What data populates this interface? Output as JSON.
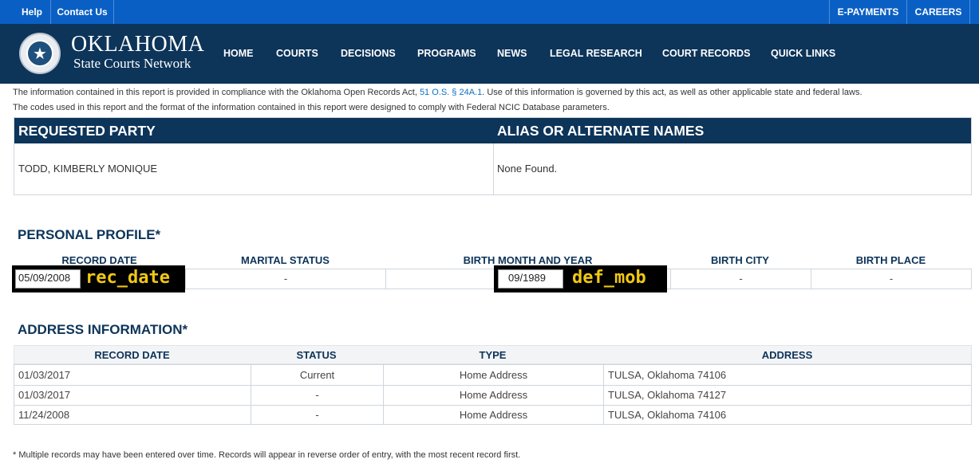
{
  "utility": {
    "help": "Help",
    "contact": "Contact Us",
    "epayments": "E-PAYMENTS",
    "careers": "CAREERS"
  },
  "brand": {
    "name": "OKLAHOMA",
    "subtitle": "State Courts Network",
    "seal_icon": "state-seal-icon"
  },
  "nav": {
    "items": [
      "HOME",
      "COURTS",
      "DECISIONS",
      "PROGRAMS",
      "NEWS",
      "LEGAL RESEARCH",
      "COURT RECORDS",
      "QUICK LINKS"
    ]
  },
  "notice": {
    "line1_before": "The information contained in this report is provided in compliance with the Oklahoma Open Records Act, ",
    "line1_link": "51 O.S. § 24A.1",
    "line1_after": ". Use of this information is governed by this act, as well as other applicable state and federal laws.",
    "line2": "The codes used in this report and the format of the information contained in this report were designed to comply with Federal NCIC Database parameters."
  },
  "party": {
    "requested_header": "REQUESTED PARTY",
    "alias_header": "ALIAS OR ALTERNATE NAMES",
    "requested_name": "TODD, KIMBERLY MONIQUE",
    "alias_value": "None Found."
  },
  "profile": {
    "title": "PERSONAL PROFILE*",
    "headers": {
      "record_date": "RECORD DATE",
      "marital_status": "MARITAL STATUS",
      "birth_month_year": "BIRTH MONTH AND YEAR",
      "birth_city": "BIRTH CITY",
      "birth_place": "BIRTH PLACE"
    },
    "row": {
      "record_date": "05/09/2008",
      "marital_status": "-",
      "birth_month_year": "09/1989",
      "birth_city": "-",
      "birth_place": "-"
    },
    "record_date_tag": "rec_date",
    "birth_tag": "def_mob"
  },
  "address": {
    "title": "ADDRESS INFORMATION*",
    "headers": {
      "record_date": "RECORD DATE",
      "status": "STATUS",
      "type": "TYPE",
      "address": "ADDRESS"
    },
    "rows": [
      {
        "record_date": "01/03/2017",
        "status": "Current",
        "type": "Home Address",
        "address": "TULSA, Oklahoma  74106"
      },
      {
        "record_date": "01/03/2017",
        "status": "-",
        "type": "Home Address",
        "address": "TULSA, Oklahoma  74127"
      },
      {
        "record_date": "11/24/2008",
        "status": "-",
        "type": "Home Address",
        "address": "TULSA, Oklahoma  74106"
      }
    ]
  },
  "footnote": "* Multiple records may have been entered over time. Records will appear in reverse order of entry, with the most recent record first."
}
